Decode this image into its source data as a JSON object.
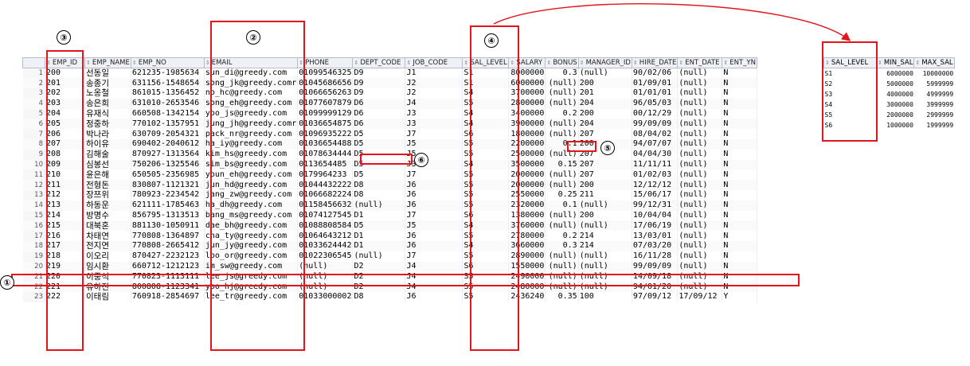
{
  "main_table": {
    "columns": [
      "EMP_ID",
      "EMP_NAME",
      "EMP_NO",
      "EMAIL",
      "PHONE",
      "DEPT_CODE",
      "JOB_CODE",
      "SAL_LEVEL",
      "SALARY",
      "BONUS",
      "MANAGER_ID",
      "HIRE_DATE",
      "ENT_DATE",
      "ENT_YN"
    ],
    "rows": [
      [
        "1",
        "200",
        "선동일",
        "621235-1985634",
        "sun_di@greedy.com",
        "01099546325",
        "D9",
        "J1",
        "S1",
        "8000000",
        "0.3",
        "(null)",
        "90/02/06",
        "(null)",
        "N"
      ],
      [
        "2",
        "201",
        "송종기",
        "631156-1548654",
        "song_jk@greedy.comr",
        "01045686656",
        "D9",
        "J2",
        "S1",
        "6000000",
        "(null)",
        "200",
        "01/09/01",
        "(null)",
        "N"
      ],
      [
        "3",
        "202",
        "노옹철",
        "861015-1356452",
        "no_hc@greedy.com",
        "01066656263",
        "D9",
        "J2",
        "S4",
        "3700000",
        "(null)",
        "201",
        "01/01/01",
        "(null)",
        "N"
      ],
      [
        "4",
        "203",
        "송은희",
        "631010-2653546",
        "song_eh@greedy.com",
        "01077607879",
        "D6",
        "J4",
        "S5",
        "2800000",
        "(null)",
        "204",
        "96/05/03",
        "(null)",
        "N"
      ],
      [
        "5",
        "204",
        "유재식",
        "660508-1342154",
        "yoo_js@greedy.com",
        "01099999129",
        "D6",
        "J3",
        "S4",
        "3400000",
        "0.2",
        "200",
        "00/12/29",
        "(null)",
        "N"
      ],
      [
        "6",
        "205",
        "정중하",
        "770102-1357951",
        "jung_jh@greedy.comr",
        "01036654875",
        "D6",
        "J3",
        "S4",
        "3900000",
        "(null)",
        "204",
        "99/09/09",
        "(null)",
        "N"
      ],
      [
        "7",
        "206",
        "박나라",
        "630709-2054321",
        "pack_nr@greedy.com",
        "01096935222",
        "D5",
        "J7",
        "S6",
        "1800000",
        "(null)",
        "207",
        "08/04/02",
        "(null)",
        "N"
      ],
      [
        "8",
        "207",
        "하이유",
        "690402-2040612",
        "ha_iy@greedy.com",
        "01036654488",
        "D5",
        "J5",
        "S5",
        "2200000",
        "0.1",
        "200",
        "94/07/07",
        "(null)",
        "N"
      ],
      [
        "9",
        "208",
        "김해술",
        "870927-1313564",
        "kim_hs@greedy.com",
        "01078634444",
        "D5",
        "J5",
        "S5",
        "2500000",
        "(null)",
        "207",
        "04/04/30",
        "(null)",
        "N"
      ],
      [
        "10",
        "209",
        "심봉선",
        "750206-1325546",
        "sim_bs@greedy.com",
        "0113654485",
        "D5",
        "J3",
        "S4",
        "3500000",
        "0.15",
        "207",
        "11/11/11",
        "(null)",
        "N"
      ],
      [
        "11",
        "210",
        "윤은해",
        "650505-2356985",
        "youn_eh@greedy.com",
        "0179964233",
        "D5",
        "J7",
        "S5",
        "2000000",
        "(null)",
        "207",
        "01/02/03",
        "(null)",
        "N"
      ],
      [
        "12",
        "211",
        "전형돈",
        "830807-1121321",
        "jun_hd@greedy.com",
        "01044432222",
        "D8",
        "J6",
        "S5",
        "2000000",
        "(null)",
        "200",
        "12/12/12",
        "(null)",
        "N"
      ],
      [
        "13",
        "212",
        "장쯔위",
        "780923-2234542",
        "jang_zw@greedy.com",
        "01066682224",
        "D8",
        "J6",
        "S5",
        "2550000",
        "0.25",
        "211",
        "15/06/17",
        "(null)",
        "N"
      ],
      [
        "14",
        "213",
        "하동운",
        "621111-1785463",
        "ha_dh@greedy.com",
        "01158456632",
        "(null)",
        "J6",
        "S5",
        "2320000",
        "0.1",
        "(null)",
        "99/12/31",
        "(null)",
        "N"
      ],
      [
        "15",
        "214",
        "방명수",
        "856795-1313513",
        "bang_ms@greedy.com",
        "01074127545",
        "D1",
        "J7",
        "S6",
        "1380000",
        "(null)",
        "200",
        "10/04/04",
        "(null)",
        "N"
      ],
      [
        "16",
        "215",
        "대북혼",
        "881130-1050911",
        "dae_bh@greedy.com",
        "01088808584",
        "D5",
        "J5",
        "S4",
        "3760000",
        "(null)",
        "(null)",
        "17/06/19",
        "(null)",
        "N"
      ],
      [
        "17",
        "216",
        "차태연",
        "770808-1364897",
        "cha_ty@greedy.com",
        "01064643212",
        "D1",
        "J6",
        "S5",
        "2780000",
        "0.2",
        "214",
        "13/03/01",
        "(null)",
        "N"
      ],
      [
        "18",
        "217",
        "전지연",
        "770808-2665412",
        "jun_jy@greedy.com",
        "01033624442",
        "D1",
        "J6",
        "S4",
        "3660000",
        "0.3",
        "214",
        "07/03/20",
        "(null)",
        "N"
      ],
      [
        "19",
        "218",
        "이오리",
        "870427-2232123",
        "loo_or@greedy.com",
        "01022306545",
        "(null)",
        "J7",
        "S5",
        "2890000",
        "(null)",
        "(null)",
        "16/11/28",
        "(null)",
        "N"
      ],
      [
        "20",
        "219",
        "임시환",
        "660712-1212123",
        "im_sw@greedy.com",
        "(null)",
        "D2",
        "J4",
        "S6",
        "1550000",
        "(null)",
        "(null)",
        "99/09/09",
        "(null)",
        "N"
      ],
      [
        "21",
        "220",
        "이중석",
        "770823-1113111",
        "lee_js@greedy.com",
        "(null)",
        "D2",
        "J4",
        "S5",
        "2490000",
        "(null)",
        "(null)",
        "14/09/18",
        "(null)",
        "N"
      ],
      [
        "22",
        "221",
        "유하진",
        "800808-1123341",
        "yoo_hj@greedy.com",
        "(null)",
        "D2",
        "J4",
        "S5",
        "2480000",
        "(null)",
        "(null)",
        "94/01/20",
        "(null)",
        "N"
      ],
      [
        "23",
        "222",
        "이태림",
        "760918-2854697",
        "lee_tr@greedy.com",
        "01033000002",
        "D8",
        "J6",
        "S5",
        "2436240",
        "0.35",
        "100",
        "97/09/12",
        "17/09/12",
        "Y"
      ]
    ]
  },
  "sal_table": {
    "columns": [
      "SAL_LEVEL",
      "MIN_SAL",
      "MAX_SAL"
    ],
    "rows": [
      [
        "S1",
        "6000000",
        "10000000"
      ],
      [
        "S2",
        "5000000",
        "5999999"
      ],
      [
        "S3",
        "4000000",
        "4999999"
      ],
      [
        "S4",
        "3000000",
        "3999999"
      ],
      [
        "S5",
        "2000000",
        "2999999"
      ],
      [
        "S6",
        "1000000",
        "1999999"
      ]
    ]
  },
  "markers": [
    "①",
    "②",
    "③",
    "④",
    "⑤",
    "⑥"
  ],
  "colors": {
    "annotation": "#e3141b",
    "header_bg": "#eef1f6"
  }
}
